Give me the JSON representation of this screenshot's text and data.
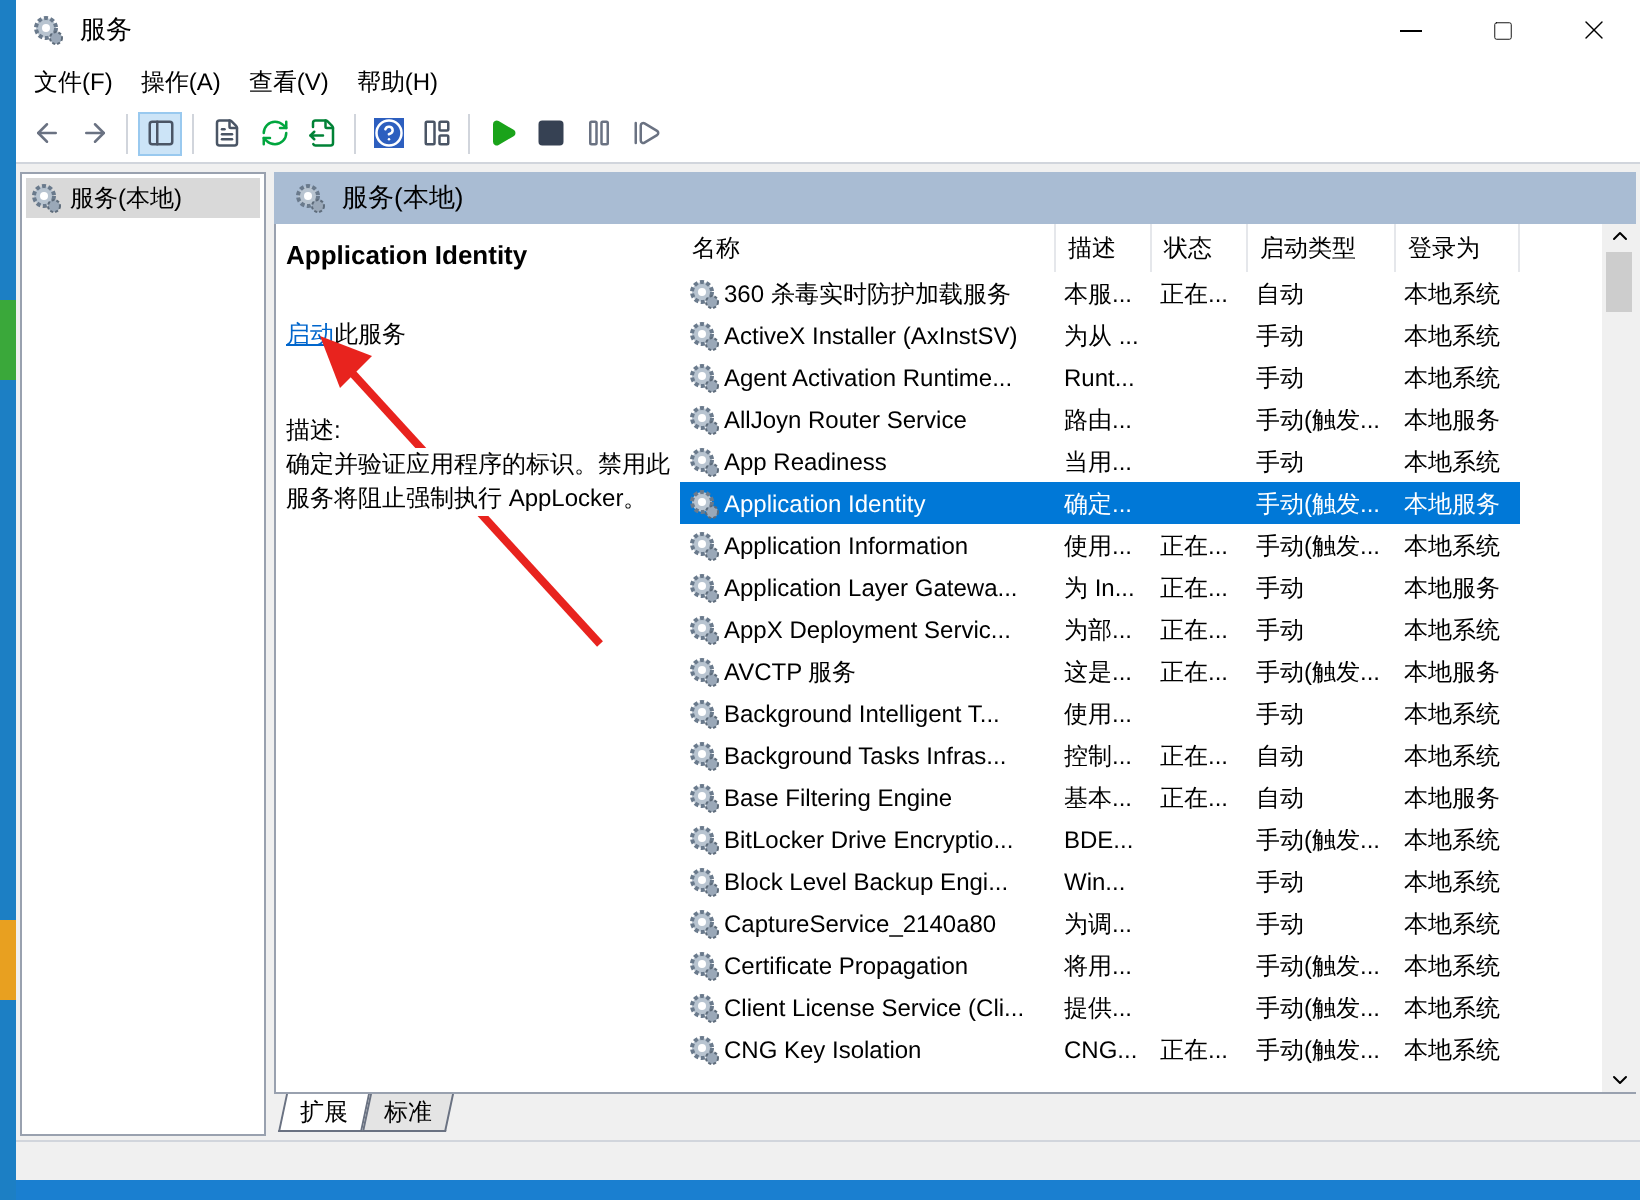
{
  "window": {
    "title": "服务"
  },
  "menu": [
    "文件(F)",
    "操作(A)",
    "查看(V)",
    "帮助(H)"
  ],
  "toolbar": [
    {
      "kind": "back"
    },
    {
      "kind": "forward"
    },
    {
      "kind": "sep"
    },
    {
      "kind": "tree",
      "selected": true
    },
    {
      "kind": "sep"
    },
    {
      "kind": "properties"
    },
    {
      "kind": "refresh"
    },
    {
      "kind": "export"
    },
    {
      "kind": "sep"
    },
    {
      "kind": "help"
    },
    {
      "kind": "view"
    },
    {
      "kind": "sep"
    },
    {
      "kind": "play"
    },
    {
      "kind": "stop"
    },
    {
      "kind": "pause"
    },
    {
      "kind": "resume"
    }
  ],
  "tree": {
    "items": [
      {
        "label": "服务(本地)",
        "selected": true
      }
    ]
  },
  "pane": {
    "title": "服务(本地)",
    "detail": {
      "service_name": "Application Identity",
      "action_link": "启动",
      "action_text": "此服务",
      "description_label": "描述:",
      "description": "确定并验证应用程序的标识。禁用此服务将阻止强制执行 AppLocker。"
    },
    "columns": [
      "名称",
      "描述",
      "状态",
      "启动类型",
      "登录为"
    ],
    "rows": [
      {
        "name": "360 杀毒实时防护加载服务",
        "description": "本服...",
        "status": "正在...",
        "startup_type": "自动",
        "log_on_as": "本地系统",
        "selected": false
      },
      {
        "name": "ActiveX Installer (AxInstSV)",
        "description": "为从 ...",
        "status": "",
        "startup_type": "手动",
        "log_on_as": "本地系统",
        "selected": false
      },
      {
        "name": "Agent Activation Runtime...",
        "description": "Runt...",
        "status": "",
        "startup_type": "手动",
        "log_on_as": "本地系统",
        "selected": false
      },
      {
        "name": "AllJoyn Router Service",
        "description": "路由...",
        "status": "",
        "startup_type": "手动(触发...",
        "log_on_as": "本地服务",
        "selected": false
      },
      {
        "name": "App Readiness",
        "description": "当用...",
        "status": "",
        "startup_type": "手动",
        "log_on_as": "本地系统",
        "selected": false
      },
      {
        "name": "Application Identity",
        "description": "确定...",
        "status": "",
        "startup_type": "手动(触发...",
        "log_on_as": "本地服务",
        "selected": true
      },
      {
        "name": "Application Information",
        "description": "使用...",
        "status": "正在...",
        "startup_type": "手动(触发...",
        "log_on_as": "本地系统",
        "selected": false
      },
      {
        "name": "Application Layer Gatewa...",
        "description": "为 In...",
        "status": "正在...",
        "startup_type": "手动",
        "log_on_as": "本地服务",
        "selected": false
      },
      {
        "name": "AppX Deployment Servic...",
        "description": "为部...",
        "status": "正在...",
        "startup_type": "手动",
        "log_on_as": "本地系统",
        "selected": false
      },
      {
        "name": "AVCTP 服务",
        "description": "这是...",
        "status": "正在...",
        "startup_type": "手动(触发...",
        "log_on_as": "本地服务",
        "selected": false
      },
      {
        "name": "Background Intelligent T...",
        "description": "使用...",
        "status": "",
        "startup_type": "手动",
        "log_on_as": "本地系统",
        "selected": false
      },
      {
        "name": "Background Tasks Infras...",
        "description": "控制...",
        "status": "正在...",
        "startup_type": "自动",
        "log_on_as": "本地系统",
        "selected": false
      },
      {
        "name": "Base Filtering Engine",
        "description": "基本...",
        "status": "正在...",
        "startup_type": "自动",
        "log_on_as": "本地服务",
        "selected": false
      },
      {
        "name": "BitLocker Drive Encryptio...",
        "description": "BDE...",
        "status": "",
        "startup_type": "手动(触发...",
        "log_on_as": "本地系统",
        "selected": false
      },
      {
        "name": "Block Level Backup Engi...",
        "description": "Win...",
        "status": "",
        "startup_type": "手动",
        "log_on_as": "本地系统",
        "selected": false
      },
      {
        "name": "CaptureService_2140a80",
        "description": "为调...",
        "status": "",
        "startup_type": "手动",
        "log_on_as": "本地系统",
        "selected": false
      },
      {
        "name": "Certificate Propagation",
        "description": "将用...",
        "status": "",
        "startup_type": "手动(触发...",
        "log_on_as": "本地系统",
        "selected": false
      },
      {
        "name": "Client License Service (Cli...",
        "description": "提供...",
        "status": "",
        "startup_type": "手动(触发...",
        "log_on_as": "本地系统",
        "selected": false
      },
      {
        "name": "CNG Key Isolation",
        "description": "CNG...",
        "status": "正在...",
        "startup_type": "手动(触发...",
        "log_on_as": "本地系统",
        "selected": false
      }
    ],
    "tabs": [
      {
        "label": "扩展",
        "selected": true
      },
      {
        "label": "标准",
        "selected": false
      }
    ]
  }
}
